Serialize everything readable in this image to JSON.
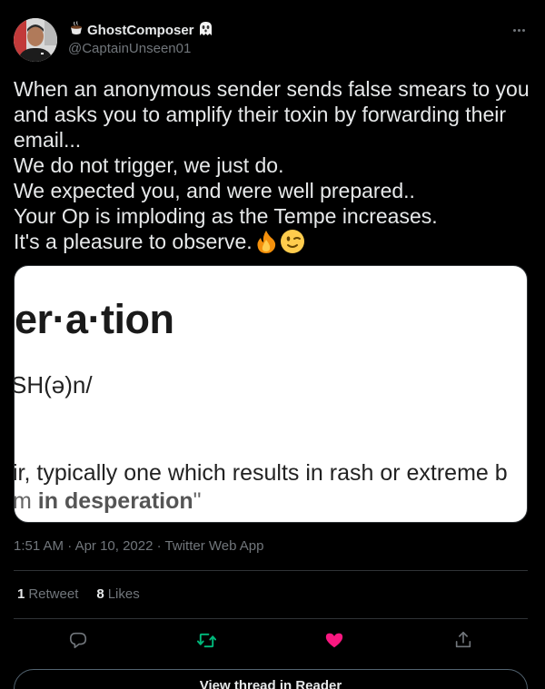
{
  "author": {
    "display_name": "GhostComposer",
    "handle": "@CaptainUnseen01",
    "name_prefix_emoji": "coffee-icon",
    "name_suffix_emoji": "ghost-icon"
  },
  "tweet": {
    "lines": [
      "When an anonymous sender sends false smears to you",
      "and asks you to amplify their toxin by forwarding their",
      "email...",
      "We do not trigger, we just do.",
      "We expected you, and were well prepared..",
      "Your Op is imploding as the Tempe increases.",
      "It's a pleasure to observe."
    ],
    "trailing_emojis": [
      "fire-icon",
      "winking-face-icon"
    ]
  },
  "media": {
    "word": "er·a·tion",
    "pronunciation": "SH(ə)n/",
    "definition": "ir, typically one which results in rash or extreme b",
    "example_prefix": "m ",
    "example_bold": "in desperation",
    "example_suffix": "\""
  },
  "meta": {
    "time": "1:51 AM",
    "date": "Apr 10, 2022",
    "source": "Twitter Web App",
    "separator": " · "
  },
  "stats": {
    "retweets_count": "1",
    "retweets_label": "Retweet",
    "likes_count": "8",
    "likes_label": "Likes"
  },
  "actions": {
    "reply_icon": "reply-icon",
    "retweet_icon": "retweet-icon",
    "like_icon": "heart-icon",
    "share_icon": "share-icon"
  },
  "colors": {
    "background": "#000000",
    "text": "#e7e9ea",
    "secondary": "#71767b",
    "retweet_green": "#00ba7c",
    "like_pink": "#f91880",
    "border": "#2f3336"
  },
  "reader_button": {
    "label": "View thread in Reader"
  }
}
